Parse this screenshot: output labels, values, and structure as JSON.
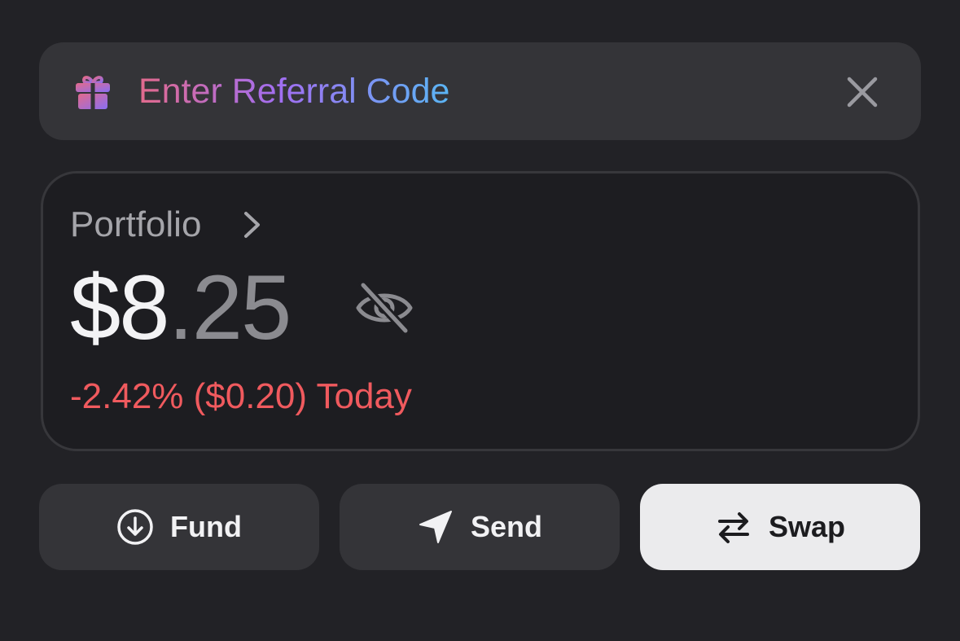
{
  "referral": {
    "label": "Enter Referral Code",
    "icon": "gift-icon",
    "close_icon": "close-icon",
    "gradient": [
      "#e26a8c",
      "#a26ef2",
      "#5ab5f4"
    ]
  },
  "portfolio": {
    "label": "Portfolio",
    "balance_integer": "$8",
    "balance_decimal": ".25",
    "hide_icon": "eye-off-icon",
    "change_text": "-2.42% ($0.20) Today",
    "change_color": "#f05a5e"
  },
  "actions": [
    {
      "label": "Fund",
      "icon": "download-circle-icon"
    },
    {
      "label": "Send",
      "icon": "send-icon"
    },
    {
      "label": "Swap",
      "icon": "swap-icon"
    }
  ]
}
